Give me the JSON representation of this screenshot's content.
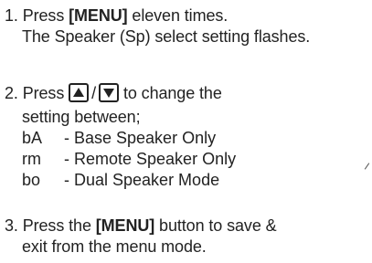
{
  "steps": [
    {
      "number": "1.",
      "prefix": "Press ",
      "key": "[MENU]",
      "suffix": " eleven times.",
      "line2": "The Speaker (Sp) select setting flashes."
    },
    {
      "number": "2.",
      "prefix": "Press ",
      "separator": "/",
      "suffix": "to change the",
      "line2": "setting between;",
      "options": [
        {
          "code": "bA",
          "description": "- Base Speaker Only"
        },
        {
          "code": "rm",
          "description": "- Remote Speaker Only"
        },
        {
          "code": "bo",
          "description": "- Dual Speaker Mode"
        }
      ]
    },
    {
      "number": "3.",
      "prefix": "Press the ",
      "key": "[MENU]",
      "suffix": " button to save &",
      "line2": "exit from the menu mode."
    }
  ],
  "icons": {
    "up_key": "up-arrow-key-icon",
    "down_key": "down-arrow-key-icon"
  }
}
